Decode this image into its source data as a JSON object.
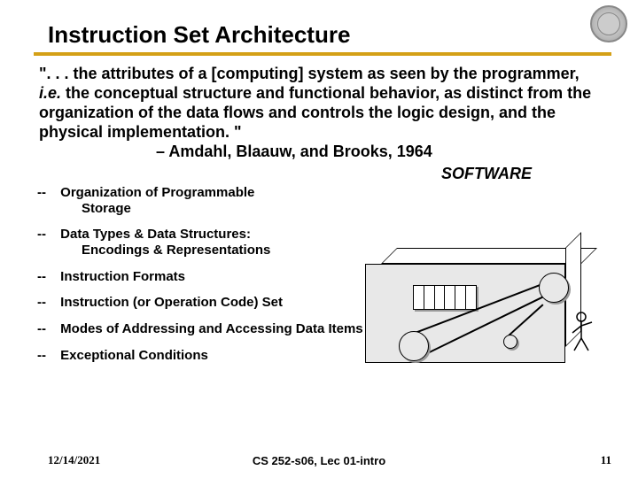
{
  "title": "Instruction Set Architecture",
  "quote": {
    "pre": "\". . . the attributes of a [computing] system as seen by the programmer, ",
    "ie": "i.e.",
    "post": "  the conceptual structure and functional behavior, as distinct from the organization of the data flows and controls the logic design, and the physical implementation. \""
  },
  "attribution": "– Amdahl, Blaauw, and Brooks,  1964",
  "software_label": "SOFTWARE",
  "bullets": [
    {
      "dash": "--",
      "line1": "Organization of Programmable",
      "line2": "Storage",
      "wide": false
    },
    {
      "dash": "--",
      "line1": "Data Types & Data Structures:",
      "line2": "Encodings & Representations",
      "wide": false
    },
    {
      "dash": "--",
      "line1": "Instruction Formats",
      "line2": "",
      "wide": false
    },
    {
      "dash": "--",
      "line1": "Instruction (or Operation Code) Set",
      "line2": "",
      "wide": false
    },
    {
      "dash": "--",
      "line1": "Modes of Addressing and Accessing Data Items and Instructions",
      "line2": "",
      "wide": true
    },
    {
      "dash": "--",
      "line1": "Exceptional Conditions",
      "line2": "",
      "wide": true
    }
  ],
  "footer": {
    "date": "12/14/2021",
    "course": "CS 252-s06, Lec 01-intro",
    "page": "11"
  }
}
